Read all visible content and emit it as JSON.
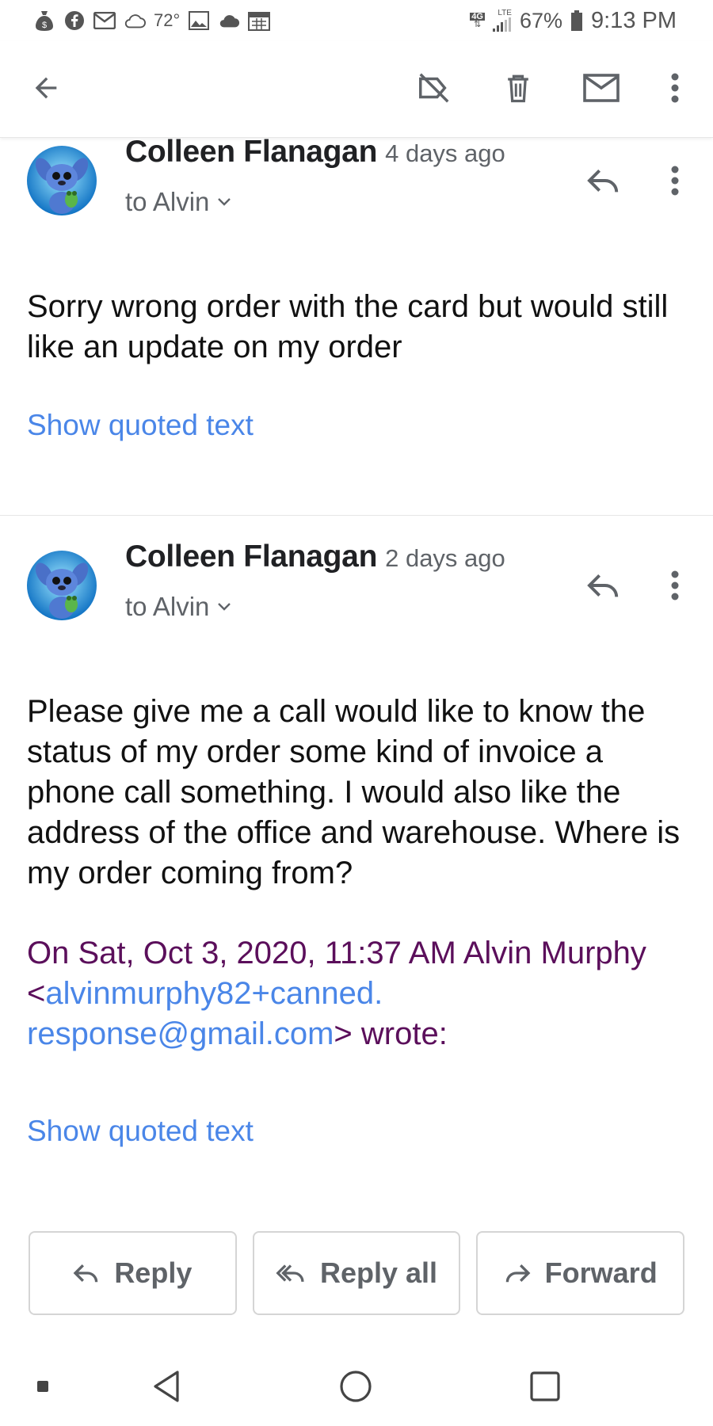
{
  "status_bar": {
    "temperature": "72°",
    "network": "4G",
    "network_sub": "LTE",
    "battery": "67%",
    "time": "9:13 PM"
  },
  "toolbar": {
    "back_icon": "arrow-left-icon",
    "label_off_icon": "label-off-icon",
    "delete_icon": "trash-icon",
    "mark_unread_icon": "mail-icon",
    "more_icon": "more-vert-icon"
  },
  "messages": [
    {
      "sender": "Colleen Flanagan",
      "date": "4 days ago",
      "to": "to Alvin",
      "body": "Sorry wrong order with the card but would still like an update on my order",
      "show_quoted": "Show quoted text"
    },
    {
      "sender": "Colleen Flanagan",
      "date": "2 days ago",
      "to": "to Alvin",
      "body": "Please give me a call would like to know the status of my order some kind of invoice a phone call something. I would also like the address of the office and warehouse. Where is my order coming from?",
      "quote_prefix": "On Sat, Oct 3, 2020, 11:37 AM Alvin Murphy <",
      "quote_email_1": "alvinmurphy82+canned.",
      "quote_email_2": "response@gmail.com",
      "quote_suffix": "> wrote:",
      "show_quoted": "Show quoted text"
    }
  ],
  "actions": {
    "reply": "Reply",
    "reply_all": "Reply all",
    "forward": "Forward"
  },
  "colors": {
    "link": "#4a86e8",
    "quote_header": "#5b0f5b",
    "secondary_text": "#5f6368"
  }
}
